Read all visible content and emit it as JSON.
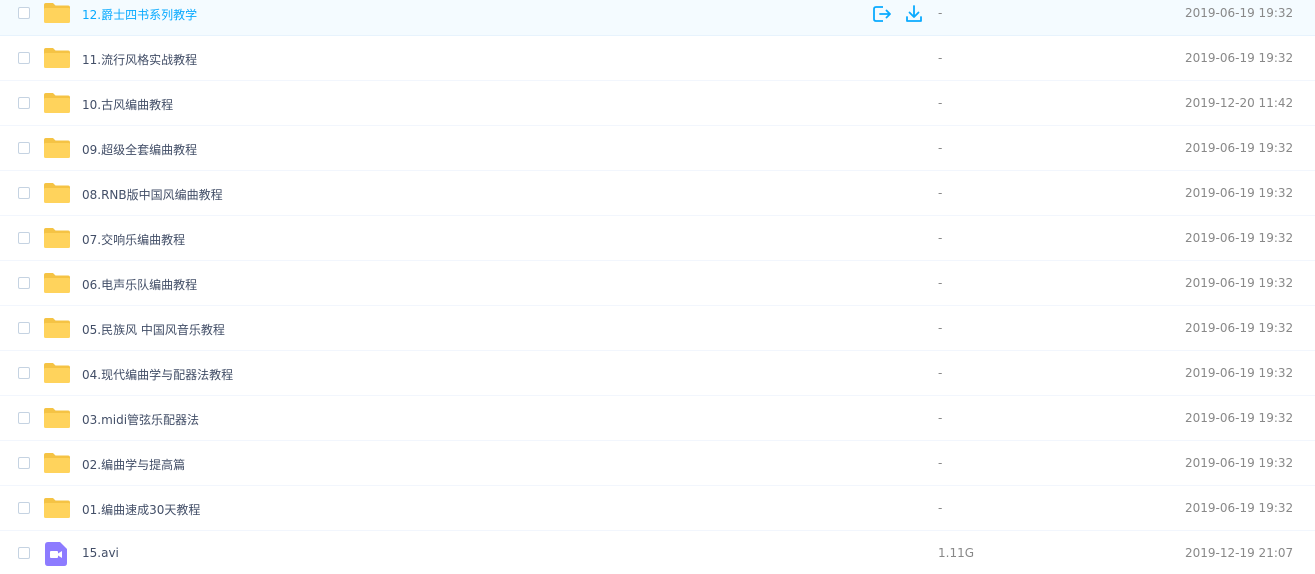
{
  "colors": {
    "folder": "#ffd35c",
    "folder_tab": "#f5c344",
    "video_icon": "#8d7bff",
    "hover_text": "#09aaff",
    "action_icon": "#09aaff"
  },
  "files": [
    {
      "name": "12.爵士四书系列教学",
      "size": "-",
      "date": "2019-06-19 19:32",
      "type": "folder",
      "hovered": true
    },
    {
      "name": "11.流行风格实战教程",
      "size": "-",
      "date": "2019-06-19 19:32",
      "type": "folder"
    },
    {
      "name": "10.古风编曲教程",
      "size": "-",
      "date": "2019-12-20 11:42",
      "type": "folder"
    },
    {
      "name": "09.超级全套编曲教程",
      "size": "-",
      "date": "2019-06-19 19:32",
      "type": "folder"
    },
    {
      "name": "08.RNB版中国风编曲教程",
      "size": "-",
      "date": "2019-06-19 19:32",
      "type": "folder"
    },
    {
      "name": "07.交响乐编曲教程",
      "size": "-",
      "date": "2019-06-19 19:32",
      "type": "folder"
    },
    {
      "name": "06.电声乐队编曲教程",
      "size": "-",
      "date": "2019-06-19 19:32",
      "type": "folder"
    },
    {
      "name": "05.民族风 中国风音乐教程",
      "size": "-",
      "date": "2019-06-19 19:32",
      "type": "folder"
    },
    {
      "name": "04.现代编曲学与配器法教程",
      "size": "-",
      "date": "2019-06-19 19:32",
      "type": "folder"
    },
    {
      "name": "03.midi管弦乐配器法",
      "size": "-",
      "date": "2019-06-19 19:32",
      "type": "folder"
    },
    {
      "name": "02.编曲学与提高篇",
      "size": "-",
      "date": "2019-06-19 19:32",
      "type": "folder"
    },
    {
      "name": "01.编曲速成30天教程",
      "size": "-",
      "date": "2019-06-19 19:32",
      "type": "folder"
    },
    {
      "name": "15.avi",
      "size": "1.11G",
      "date": "2019-12-19 21:07",
      "type": "video"
    }
  ],
  "icons": {
    "folder": "folder-icon",
    "video": "video-file-icon",
    "share": "share-icon",
    "download": "download-icon",
    "checkbox": "checkbox"
  }
}
